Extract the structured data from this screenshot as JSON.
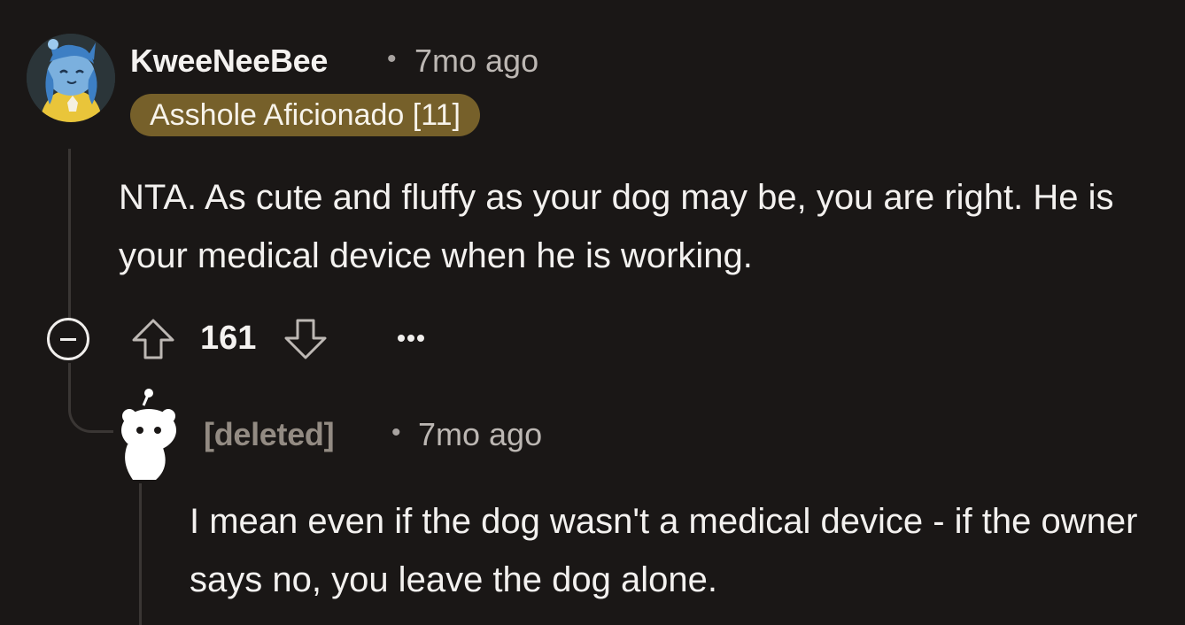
{
  "comment": {
    "username": "KweeNeeBee",
    "separator": "•",
    "time": "7mo ago",
    "flair": "Asshole Aficionado [11]",
    "body": "NTA. As cute and fluffy as your dog may be, you are right. He is your medical device when he is working.",
    "score": "161",
    "icons": {
      "collapse": "collapse-minus-icon",
      "upvote": "upvote-arrow-icon",
      "downvote": "downvote-arrow-icon",
      "more": "more-options-icon"
    }
  },
  "reply": {
    "username": "[deleted]",
    "separator": "•",
    "time": "7mo ago",
    "body": "I mean even if the dog wasn't a medical device - if the owner says no, you leave the dog alone."
  },
  "colors": {
    "background": "#1a1716",
    "flair_bg": "#76602a",
    "thread_line": "#3a3634",
    "deleted_username": "#938b83"
  }
}
